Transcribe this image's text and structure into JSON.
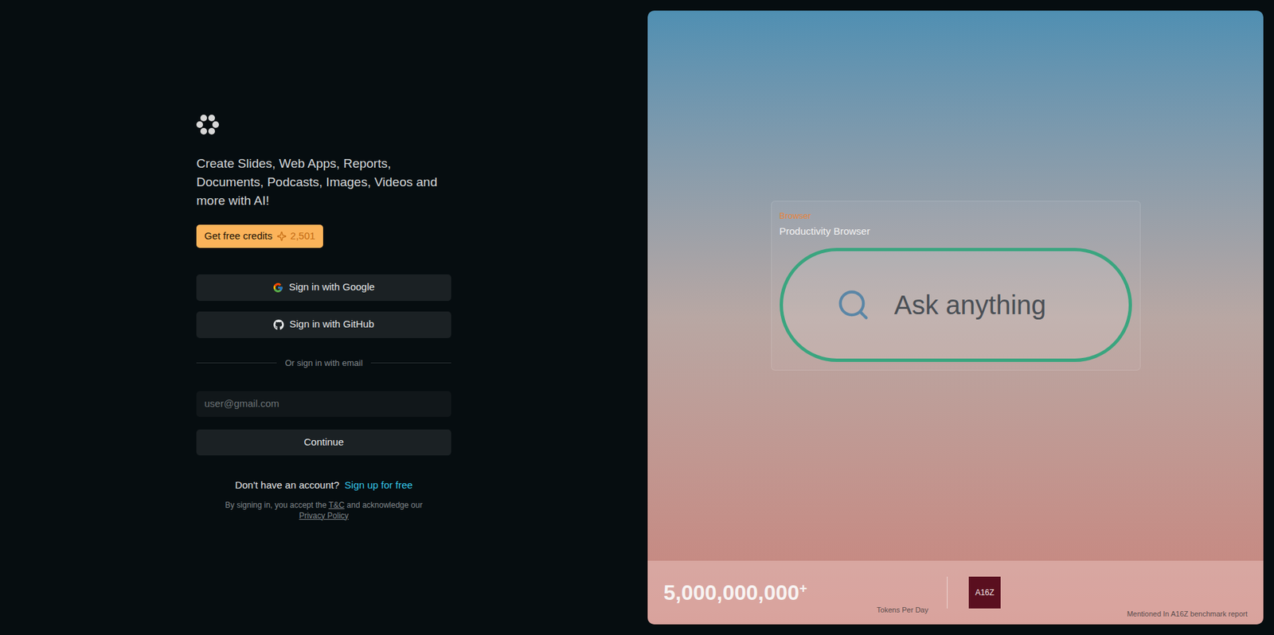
{
  "brand": {
    "tagline": "Create Slides, Web Apps, Reports, Documents, Podcasts, Images, Videos and more with AI!"
  },
  "credits_button": {
    "label": "Get free credits",
    "count": "2,501"
  },
  "auth_buttons": [
    {
      "label": "Sign in with Google",
      "kind": "google"
    },
    {
      "label": "Sign in with GitHub",
      "kind": "github"
    }
  ],
  "divider": "Or sign in with email",
  "email": {
    "placeholder": "user@gmail.com"
  },
  "continue_button": "Continue",
  "signup": {
    "prompt": "Don't have an account?",
    "link": "Sign up for free"
  },
  "legal": {
    "prefix": "By signing in, you accept the",
    "terms": "T&C",
    "middle": "and acknowledge our",
    "privacy": "Privacy Policy"
  },
  "showcase": {
    "tag": "Browser",
    "title": "Productivity Browser",
    "search_placeholder": "Ask anything"
  },
  "stats": {
    "value": "5,000,000,000",
    "suffix": "+",
    "label": "Tokens Per Day",
    "badge": "A16Z",
    "note": "Mentioned In A16Z benchmark report"
  }
}
